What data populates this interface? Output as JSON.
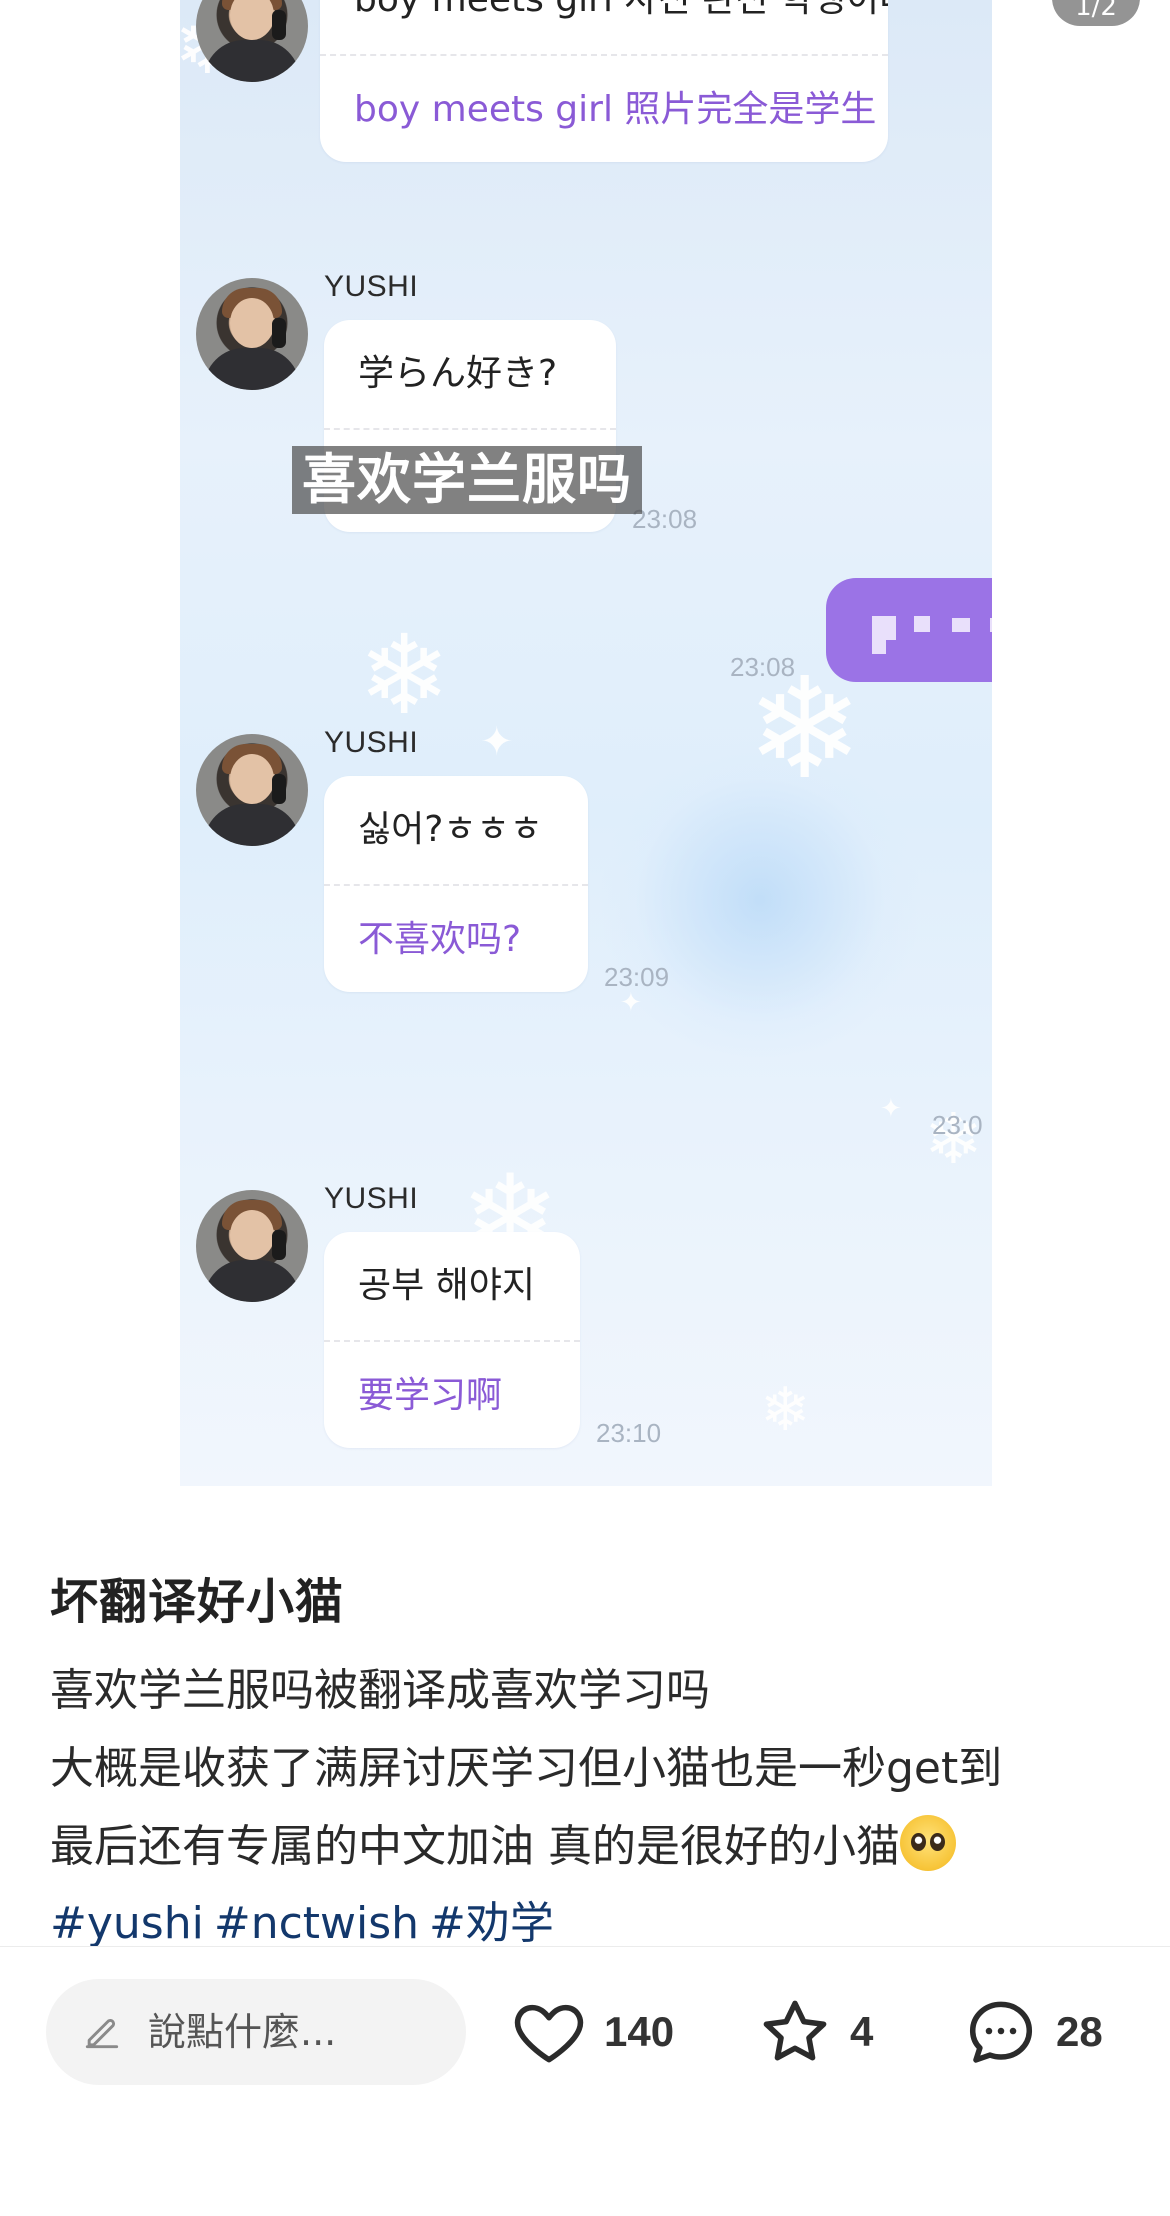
{
  "image_viewer": {
    "page_indicator": "1/2",
    "active_dot_color": "#ff2442",
    "chat": {
      "sender": "YUSHI",
      "messages": [
        {
          "original": "boy meets girl 사진 완전 학생이다",
          "translation": "boy meets girl 照片完全是学生"
        },
        {
          "original": "学らん好き?",
          "translation": "",
          "time": "23:08"
        },
        {
          "original": "싫어?ㅎㅎㅎ",
          "translation": "不喜欢吗?",
          "time": "23:09"
        },
        {
          "original": "공부 해야지",
          "translation": "要学习啊",
          "time": "23:10"
        }
      ],
      "sent_time": "23:08",
      "partial_time": "23:0",
      "subtitle_overlay": "喜欢学兰服吗",
      "sent_bubble_color": "#9b73e6",
      "translation_color": "#8a5ad6"
    }
  },
  "post": {
    "title": "坏翻译好小猫",
    "body_lines": [
      "喜欢学兰服吗被翻译成喜欢学习吗",
      "大概是收获了满屏讨厌学习但小猫也是一秒get到",
      "最后还有专属的中文加油 真的是很好的小猫"
    ],
    "hashtags": [
      "#yushi",
      "#nctwish",
      "#劝学"
    ],
    "hashtag_color": "#13386c"
  },
  "bottom_bar": {
    "comment_placeholder": "說點什麼...",
    "likes": "140",
    "favorites": "4",
    "comments": "28"
  }
}
